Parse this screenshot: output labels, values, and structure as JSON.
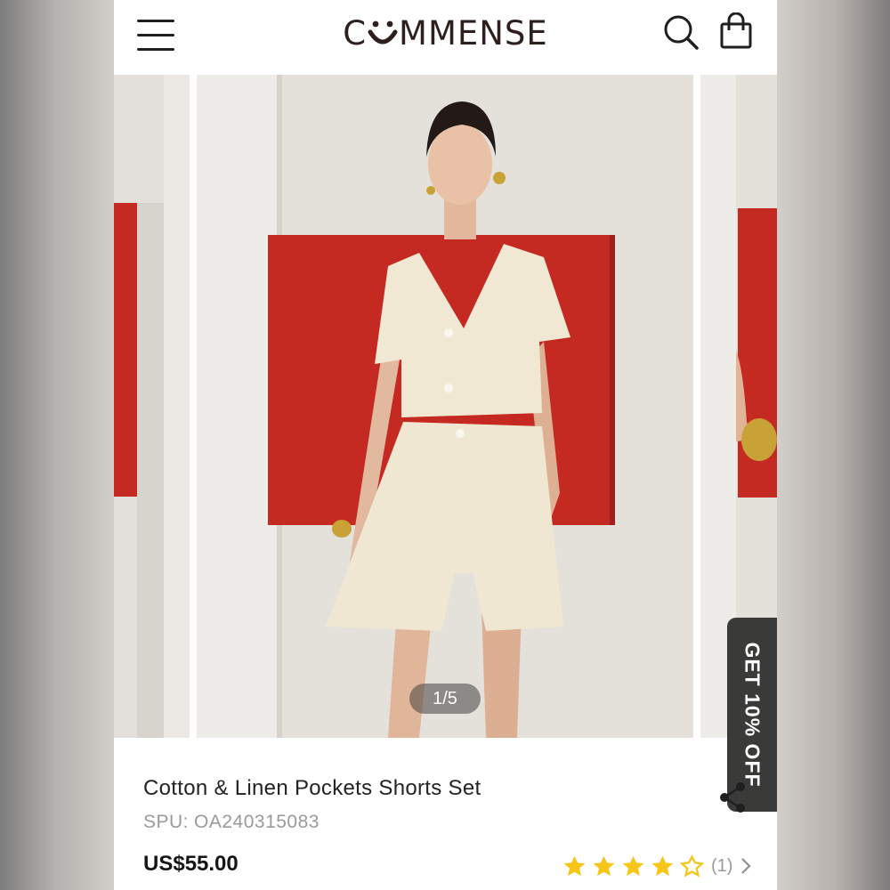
{
  "header": {
    "brand_before": "C",
    "brand_after": "MMENSE",
    "icons": {
      "menu": "hamburger-menu-icon",
      "search": "search-icon",
      "bag": "shopping-bag-icon"
    }
  },
  "gallery": {
    "pager_text": "1/5",
    "promo_tab_label": "GET 10% OFF"
  },
  "product": {
    "title": "Cotton & Linen Pockets Shorts Set",
    "spu_label": "SPU:",
    "spu_value": "OA240315083",
    "price": "US$55.00",
    "rating": {
      "value": 4,
      "max": 5,
      "count_text": "(1)"
    }
  },
  "colors": {
    "accent_red": "#c42a22",
    "star": "#f5c518",
    "text_dark": "#232323",
    "text_muted": "#9a9a9a"
  }
}
